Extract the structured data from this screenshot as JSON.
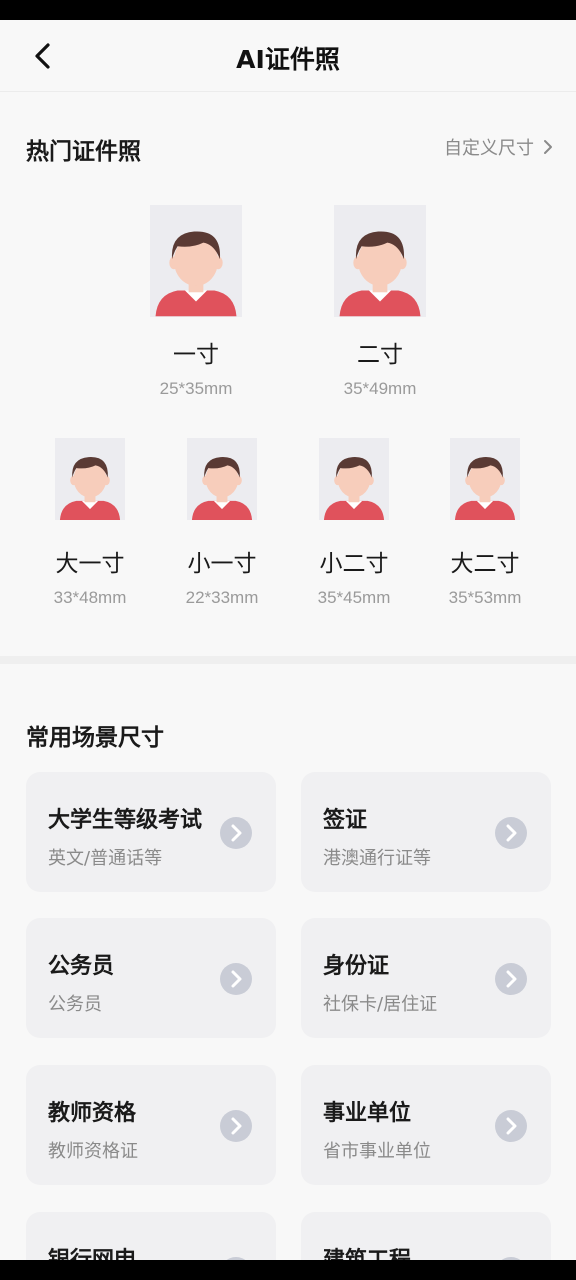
{
  "header": {
    "title": "AI证件照"
  },
  "hot": {
    "title": "热门证件照",
    "custom_label": "自定义尺寸",
    "large": [
      {
        "name": "一寸",
        "size": "25*35mm"
      },
      {
        "name": "二寸",
        "size": "35*49mm"
      }
    ],
    "small": [
      {
        "name": "大一寸",
        "size": "33*48mm"
      },
      {
        "name": "小一寸",
        "size": "22*33mm"
      },
      {
        "name": "小二寸",
        "size": "35*45mm"
      },
      {
        "name": "大二寸",
        "size": "35*53mm"
      }
    ]
  },
  "scenes": {
    "title": "常用场景尺寸",
    "items": [
      {
        "title": "大学生等级考试",
        "sub": "英文/普通话等"
      },
      {
        "title": "签证",
        "sub": "港澳通行证等"
      },
      {
        "title": "公务员",
        "sub": "公务员"
      },
      {
        "title": "身份证",
        "sub": "社保卡/居住证"
      },
      {
        "title": "教师资格",
        "sub": "教师资格证"
      },
      {
        "title": "事业单位",
        "sub": "省市事业单位"
      },
      {
        "title": "银行网申",
        "sub": ""
      },
      {
        "title": "建筑工程",
        "sub": ""
      }
    ]
  },
  "colors": {
    "shirt": "#e0525c",
    "hair": "#5a3a34",
    "skin": "#f7cdbb",
    "photo_bg": "#ececf0"
  }
}
